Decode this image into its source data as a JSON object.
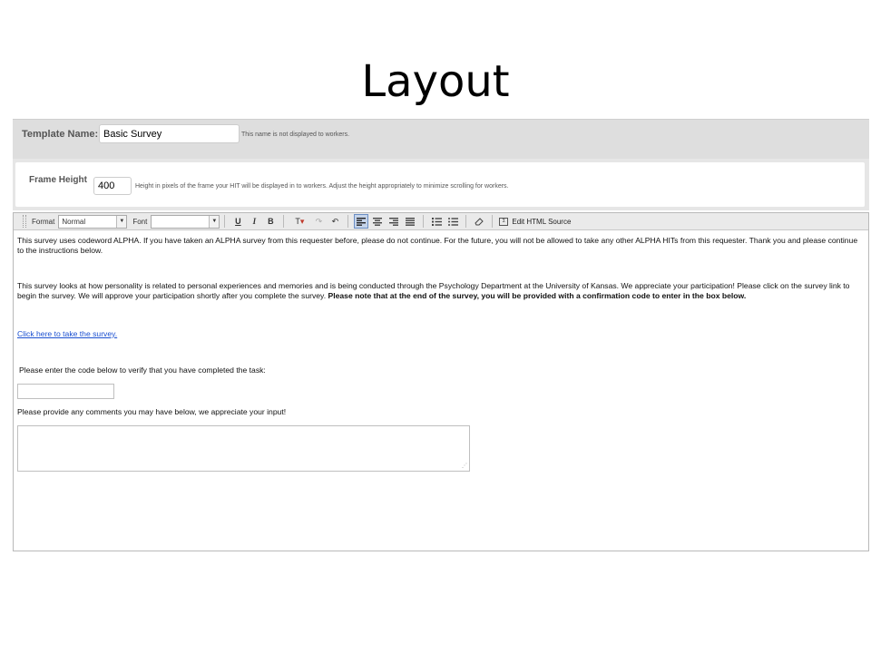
{
  "slide": {
    "title": "Layout"
  },
  "template": {
    "label": "Template Name:",
    "value": "Basic Survey",
    "hint": "This name is not displayed to workers."
  },
  "frame": {
    "label": "Frame Height",
    "value": "400",
    "hint": "Height in pixels of the frame your HIT will be displayed in to workers. Adjust the height appropriately to minimize scrolling for workers."
  },
  "toolbar": {
    "format_label": "Format",
    "format_value": "Normal",
    "font_label": "Font",
    "font_value": "",
    "underline": "U",
    "italic": "I",
    "bold": "B",
    "edit_html": "Edit HTML Source",
    "icons": [
      "grip-icon",
      "chevron-down-icon",
      "underline-icon",
      "italic-icon",
      "bold-icon",
      "text-color-icon",
      "redo-icon",
      "undo-icon",
      "align-left-icon",
      "align-center-icon",
      "align-right-icon",
      "align-justify-icon",
      "ordered-list-icon",
      "unordered-list-icon",
      "eraser-icon",
      "html-source-icon"
    ]
  },
  "content": {
    "para1": "This survey uses codeword ALPHA. If you have taken an ALPHA survey from this requester before, please do not continue. For the future, you will not be allowed to take any other ALPHA HITs from this requester. Thank you and please continue to the instructions below.",
    "para2_text": "This survey looks at how personality is related to personal experiences and memories and is being conducted through the Psychology Department at the University of Kansas. We appreciate your participation! Please click on the survey link to begin the survey. We will approve your participation shortly after you complete the survey.",
    "para2_bold": "Please note that at the end of the survey, you will be provided with a confirmation code to enter in the box below.",
    "link": "Click here to take the survey.",
    "verify_label": "Please enter the code below to verify that you have completed the task:",
    "code_value": "",
    "comments_label": "Please provide any comments you may have below, we appreciate your input!",
    "comments_value": ""
  },
  "colors": {
    "link": "#1a4fd0",
    "panel_gray": "#dedede",
    "toolbar_bg": "#eaeaea",
    "active_button": "#c5d4ea"
  }
}
